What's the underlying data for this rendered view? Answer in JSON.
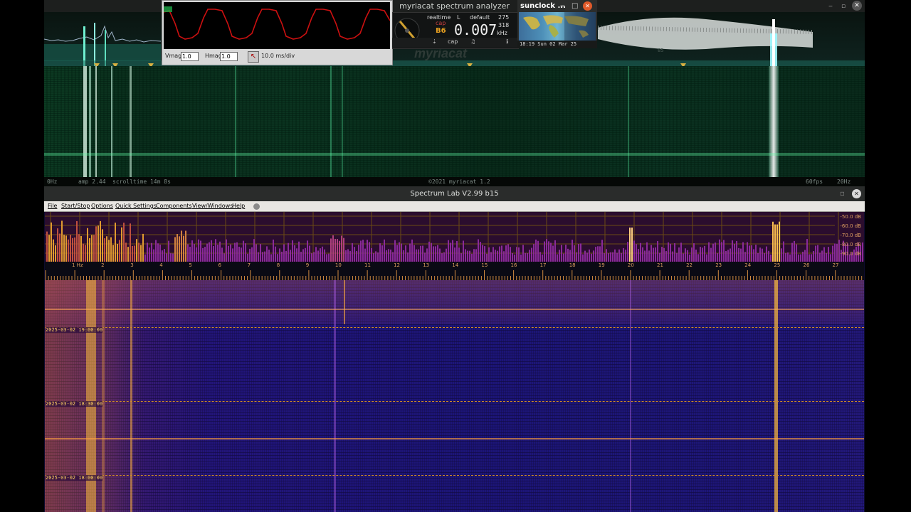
{
  "myriacat": {
    "title": "myriacat spectrum analyzer",
    "status_left": "0Hz",
    "status_amp": "amp 2.44",
    "status_scroll": "scrolltime 14m 8s",
    "status_center": "©2021 myriacat 1.2",
    "status_fps": "60fps",
    "status_right": "20Hz",
    "meter": {
      "mode": "realtime",
      "channel": "L",
      "preset": "default",
      "top_number": "275",
      "capture_label": "cap",
      "level_small": "B6",
      "main_value": "0.007",
      "sub_number": "318",
      "unit": "kHz",
      "btn_cap": "cap"
    },
    "watermark": "myriacat",
    "spectrum_level_label": "85"
  },
  "scope": {
    "vmag_label": "Vmag",
    "vmag_value": "1.0",
    "hmag_label": "Hmag",
    "hmag_value": "1.0",
    "timebase": "10.0 ms/div"
  },
  "sunclock": {
    "title": "sunclock ...",
    "footer": "18:19 Sun 02 Mar 25"
  },
  "spectrumlab": {
    "title": "Spectrum Lab V2.99 b15",
    "menu": [
      "File",
      "Start/Stop",
      "Options",
      "Quick Settings",
      "Components",
      "View/Windows",
      "Help"
    ],
    "db_labels": [
      "-50.0 dB",
      "-60.0 dB",
      "-70.0 dB",
      "-80.0 dB",
      "-90.0 dB"
    ],
    "freq_ticks": [
      "1 Hz",
      "2",
      "3",
      "4",
      "5",
      "6",
      "7",
      "8",
      "9",
      "10",
      "11",
      "12",
      "13",
      "14",
      "15",
      "16",
      "17",
      "18",
      "19",
      "20",
      "21",
      "22",
      "23",
      "24",
      "25",
      "26",
      "27"
    ],
    "timestamps": [
      "2025-03-02 19:00:00",
      "2025-03-02 18:30:00",
      "2025-03-02 18:00:00"
    ]
  },
  "colors": {
    "waterfall_green": "#2bd88a",
    "waterfall_purple": "#1c1578",
    "hot_orange": "#ffb030",
    "scope_trace": "#cc0000"
  }
}
